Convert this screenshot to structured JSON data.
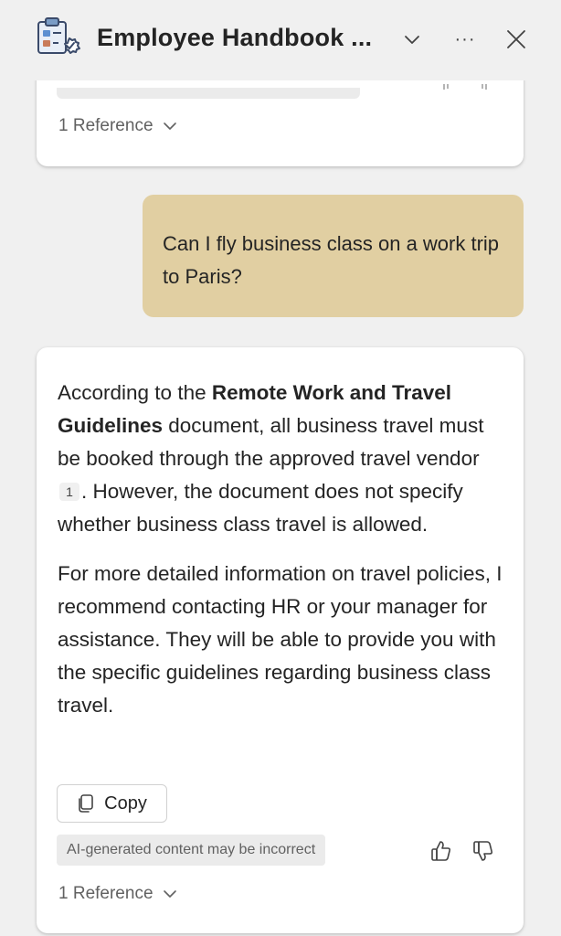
{
  "header": {
    "title": "Employee Handbook ...",
    "more_glyph": "···"
  },
  "previous_card": {
    "reference_label": "1 Reference"
  },
  "user_message": {
    "text": "Can I fly business class on a work trip to Paris?"
  },
  "response": {
    "p1": {
      "before": "According to the ",
      "bold": "Remote Work and Travel Guidelines",
      "middle": " document, all business travel must be booked through the approved travel vendor ",
      "citation": "1",
      "after": ". However, the document does not specify whether business class travel is allowed."
    },
    "p2": "For more detailed information on travel policies, I recommend contacting HR or your manager for assistance. They will be able to provide you with the specific guidelines regarding business class travel.",
    "copy_label": "Copy",
    "ai_disclaimer": "AI-generated content may be incorrect",
    "reference_label": "1 Reference"
  },
  "icons": {
    "app": "handbook-clipboard-icon",
    "title_dropdown": "chevron-down-icon",
    "more": "more-options-icon",
    "close": "close-icon",
    "copy": "copy-icon",
    "like": "thumbs-up-icon",
    "dislike": "thumbs-down-icon",
    "reference_expand": "chevron-down-icon"
  },
  "colors": {
    "user_bubble": "#e1cfa2",
    "background": "#f0f0f0",
    "card": "#ffffff"
  }
}
